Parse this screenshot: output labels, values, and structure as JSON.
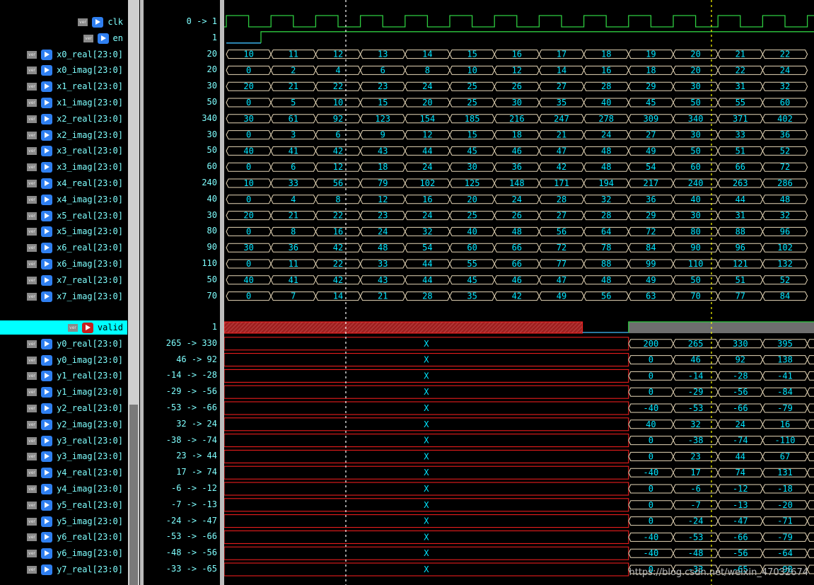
{
  "signals": [
    {
      "name": "clk",
      "value": "0 -> 1",
      "kind": "clock",
      "dir": "in"
    },
    {
      "name": "en",
      "value": "1",
      "kind": "bit",
      "dir": "in"
    },
    {
      "name": "x0_real[23:0]",
      "value": "20",
      "kind": "bus",
      "dir": "in",
      "values": [
        "10",
        "11",
        "12",
        "13",
        "14",
        "15",
        "16",
        "17",
        "18",
        "19",
        "20",
        "21",
        "22"
      ]
    },
    {
      "name": "x0_imag[23:0]",
      "value": "20",
      "kind": "bus",
      "dir": "in",
      "values": [
        "0",
        "2",
        "4",
        "6",
        "8",
        "10",
        "12",
        "14",
        "16",
        "18",
        "20",
        "22",
        "24"
      ]
    },
    {
      "name": "x1_real[23:0]",
      "value": "30",
      "kind": "bus",
      "dir": "in",
      "values": [
        "20",
        "21",
        "22",
        "23",
        "24",
        "25",
        "26",
        "27",
        "28",
        "29",
        "30",
        "31",
        "32"
      ]
    },
    {
      "name": "x1_imag[23:0]",
      "value": "50",
      "kind": "bus",
      "dir": "in",
      "values": [
        "0",
        "5",
        "10",
        "15",
        "20",
        "25",
        "30",
        "35",
        "40",
        "45",
        "50",
        "55",
        "60"
      ]
    },
    {
      "name": "x2_real[23:0]",
      "value": "340",
      "kind": "bus",
      "dir": "in",
      "values": [
        "30",
        "61",
        "92",
        "123",
        "154",
        "185",
        "216",
        "247",
        "278",
        "309",
        "340",
        "371",
        "402"
      ]
    },
    {
      "name": "x2_imag[23:0]",
      "value": "30",
      "kind": "bus",
      "dir": "in",
      "values": [
        "0",
        "3",
        "6",
        "9",
        "12",
        "15",
        "18",
        "21",
        "24",
        "27",
        "30",
        "33",
        "36"
      ]
    },
    {
      "name": "x3_real[23:0]",
      "value": "50",
      "kind": "bus",
      "dir": "in",
      "values": [
        "40",
        "41",
        "42",
        "43",
        "44",
        "45",
        "46",
        "47",
        "48",
        "49",
        "50",
        "51",
        "52"
      ]
    },
    {
      "name": "x3_imag[23:0]",
      "value": "60",
      "kind": "bus",
      "dir": "in",
      "values": [
        "0",
        "6",
        "12",
        "18",
        "24",
        "30",
        "36",
        "42",
        "48",
        "54",
        "60",
        "66",
        "72"
      ]
    },
    {
      "name": "x4_real[23:0]",
      "value": "240",
      "kind": "bus",
      "dir": "in",
      "values": [
        "10",
        "33",
        "56",
        "79",
        "102",
        "125",
        "148",
        "171",
        "194",
        "217",
        "240",
        "263",
        "286"
      ]
    },
    {
      "name": "x4_imag[23:0]",
      "value": "40",
      "kind": "bus",
      "dir": "in",
      "values": [
        "0",
        "4",
        "8",
        "12",
        "16",
        "20",
        "24",
        "28",
        "32",
        "36",
        "40",
        "44",
        "48"
      ]
    },
    {
      "name": "x5_real[23:0]",
      "value": "30",
      "kind": "bus",
      "dir": "in",
      "values": [
        "20",
        "21",
        "22",
        "23",
        "24",
        "25",
        "26",
        "27",
        "28",
        "29",
        "30",
        "31",
        "32"
      ]
    },
    {
      "name": "x5_imag[23:0]",
      "value": "80",
      "kind": "bus",
      "dir": "in",
      "values": [
        "0",
        "8",
        "16",
        "24",
        "32",
        "40",
        "48",
        "56",
        "64",
        "72",
        "80",
        "88",
        "96"
      ]
    },
    {
      "name": "x6_real[23:0]",
      "value": "90",
      "kind": "bus",
      "dir": "in",
      "values": [
        "30",
        "36",
        "42",
        "48",
        "54",
        "60",
        "66",
        "72",
        "78",
        "84",
        "90",
        "96",
        "102"
      ]
    },
    {
      "name": "x6_imag[23:0]",
      "value": "110",
      "kind": "bus",
      "dir": "in",
      "values": [
        "0",
        "11",
        "22",
        "33",
        "44",
        "55",
        "66",
        "77",
        "88",
        "99",
        "110",
        "121",
        "132"
      ]
    },
    {
      "name": "x7_real[23:0]",
      "value": "50",
      "kind": "bus",
      "dir": "in",
      "values": [
        "40",
        "41",
        "42",
        "43",
        "44",
        "45",
        "46",
        "47",
        "48",
        "49",
        "50",
        "51",
        "52"
      ]
    },
    {
      "name": "x7_imag[23:0]",
      "value": "70",
      "kind": "bus",
      "dir": "in",
      "values": [
        "0",
        "7",
        "14",
        "21",
        "28",
        "35",
        "42",
        "49",
        "56",
        "63",
        "70",
        "77",
        "84"
      ]
    },
    {
      "name": "valid",
      "value": "1",
      "kind": "valid",
      "dir": "out",
      "highlight": true
    },
    {
      "name": "y0_real[23:0]",
      "value": "265 -> 330",
      "kind": "ybus",
      "dir": "out",
      "values": [
        "200",
        "265",
        "330",
        "395",
        "4"
      ]
    },
    {
      "name": "y0_imag[23:0]",
      "value": "46 -> 92",
      "kind": "ybus",
      "dir": "out",
      "values": [
        "0",
        "46",
        "92",
        "138",
        "1"
      ]
    },
    {
      "name": "y1_real[23:0]",
      "value": "-14 -> -28",
      "kind": "ybus",
      "dir": "out",
      "values": [
        "0",
        "-14",
        "-28",
        "-41",
        "-"
      ]
    },
    {
      "name": "y1_imag[23:0]",
      "value": "-29 -> -56",
      "kind": "ybus",
      "dir": "out",
      "values": [
        "0",
        "-29",
        "-56",
        "-84",
        "-"
      ]
    },
    {
      "name": "y2_real[23:0]",
      "value": "-53 -> -66",
      "kind": "ybus",
      "dir": "out",
      "values": [
        "-40",
        "-53",
        "-66",
        "-79",
        "-"
      ]
    },
    {
      "name": "y2_imag[23:0]",
      "value": "32 -> 24",
      "kind": "ybus",
      "dir": "out",
      "values": [
        "40",
        "32",
        "24",
        "16",
        ""
      ]
    },
    {
      "name": "y3_real[23:0]",
      "value": "-38 -> -74",
      "kind": "ybus",
      "dir": "out",
      "values": [
        "0",
        "-38",
        "-74",
        "-110",
        "-"
      ]
    },
    {
      "name": "y3_imag[23:0]",
      "value": "23 -> 44",
      "kind": "ybus",
      "dir": "out",
      "values": [
        "0",
        "23",
        "44",
        "67",
        ""
      ]
    },
    {
      "name": "y4_real[23:0]",
      "value": "17 -> 74",
      "kind": "ybus",
      "dir": "out",
      "values": [
        "-40",
        "17",
        "74",
        "131",
        "1"
      ]
    },
    {
      "name": "y4_imag[23:0]",
      "value": "-6 -> -12",
      "kind": "ybus",
      "dir": "out",
      "values": [
        "0",
        "-6",
        "-12",
        "-18",
        "-"
      ]
    },
    {
      "name": "y5_real[23:0]",
      "value": "-7 -> -13",
      "kind": "ybus",
      "dir": "out",
      "values": [
        "0",
        "-7",
        "-13",
        "-20",
        "-"
      ]
    },
    {
      "name": "y5_imag[23:0]",
      "value": "-24 -> -47",
      "kind": "ybus",
      "dir": "out",
      "values": [
        "0",
        "-24",
        "-47",
        "-71",
        "-"
      ]
    },
    {
      "name": "y6_real[23:0]",
      "value": "-53 -> -66",
      "kind": "ybus",
      "dir": "out",
      "values": [
        "-40",
        "-53",
        "-66",
        "-79",
        "-"
      ]
    },
    {
      "name": "y6_imag[23:0]",
      "value": "-48 -> -56",
      "kind": "ybus",
      "dir": "out",
      "values": [
        "-40",
        "-48",
        "-56",
        "-64",
        "-"
      ]
    },
    {
      "name": "y7_real[23:0]",
      "value": "-33 -> -65",
      "kind": "ybus",
      "dir": "out",
      "values": [
        "0",
        "-33",
        "-65",
        "-98",
        "-"
      ]
    }
  ],
  "badge_text": "ver",
  "unknown_text": "X",
  "watermark": "https://blog.csdn.net/weixin_47032674",
  "colors": {
    "clock": "#2ecc40",
    "bus": "#e8d8b8",
    "bus_text": "#00e5ff",
    "x_state": "#ff2020",
    "valid_fill": "#a02020",
    "cursor": "#ffff00",
    "marker": "#ffffff"
  }
}
